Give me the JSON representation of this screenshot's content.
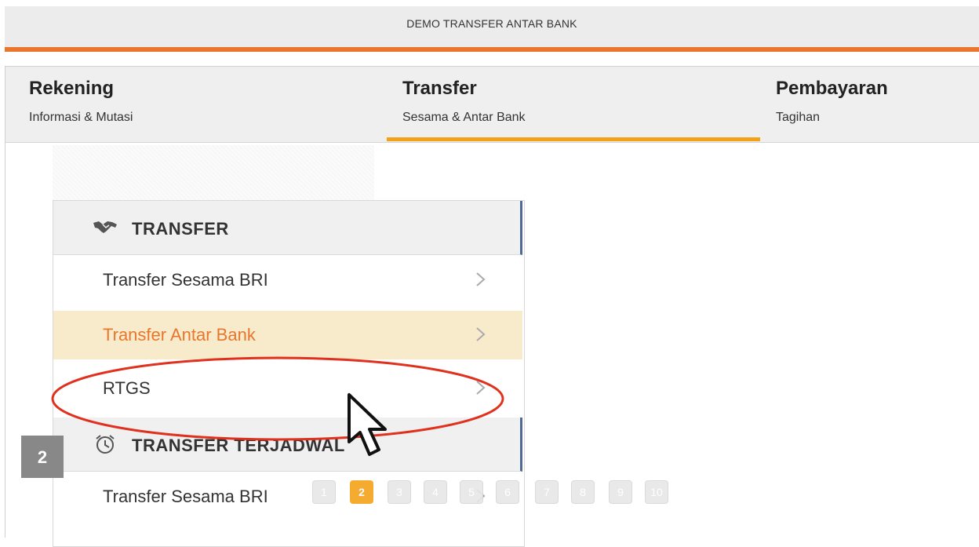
{
  "window": {
    "title": "DEMO TRANSFER ANTAR BANK"
  },
  "nav": {
    "tabs": [
      {
        "title": "Rekening",
        "subtitle": "Informasi & Mutasi"
      },
      {
        "title": "Transfer",
        "subtitle": "Sesama & Antar Bank",
        "active": true
      },
      {
        "title": "Pembayaran",
        "subtitle": "Tagihan"
      }
    ]
  },
  "menu": {
    "sections": [
      {
        "heading": "TRANSFER",
        "icon": "handshake-icon",
        "items": [
          {
            "label": "Transfer Sesama BRI"
          },
          {
            "label": "Transfer Antar Bank",
            "active": true
          },
          {
            "label": "RTGS"
          }
        ]
      },
      {
        "heading": "TRANSFER TERJADWAL",
        "icon": "alarm-clock-icon",
        "items": [
          {
            "label": "Transfer Sesama BRI"
          }
        ]
      }
    ]
  },
  "step_badge": "2",
  "pagination": {
    "pages": [
      "1",
      "2",
      "3",
      "4",
      "5",
      "6",
      "7",
      "8",
      "9",
      "10"
    ],
    "current": "2"
  },
  "colors": {
    "accent": "#e8762c",
    "tab_underline": "#f4a11a",
    "section_border": "#4d6a94",
    "active_row": "#f8ebcc",
    "annotation": "#e0311e"
  }
}
